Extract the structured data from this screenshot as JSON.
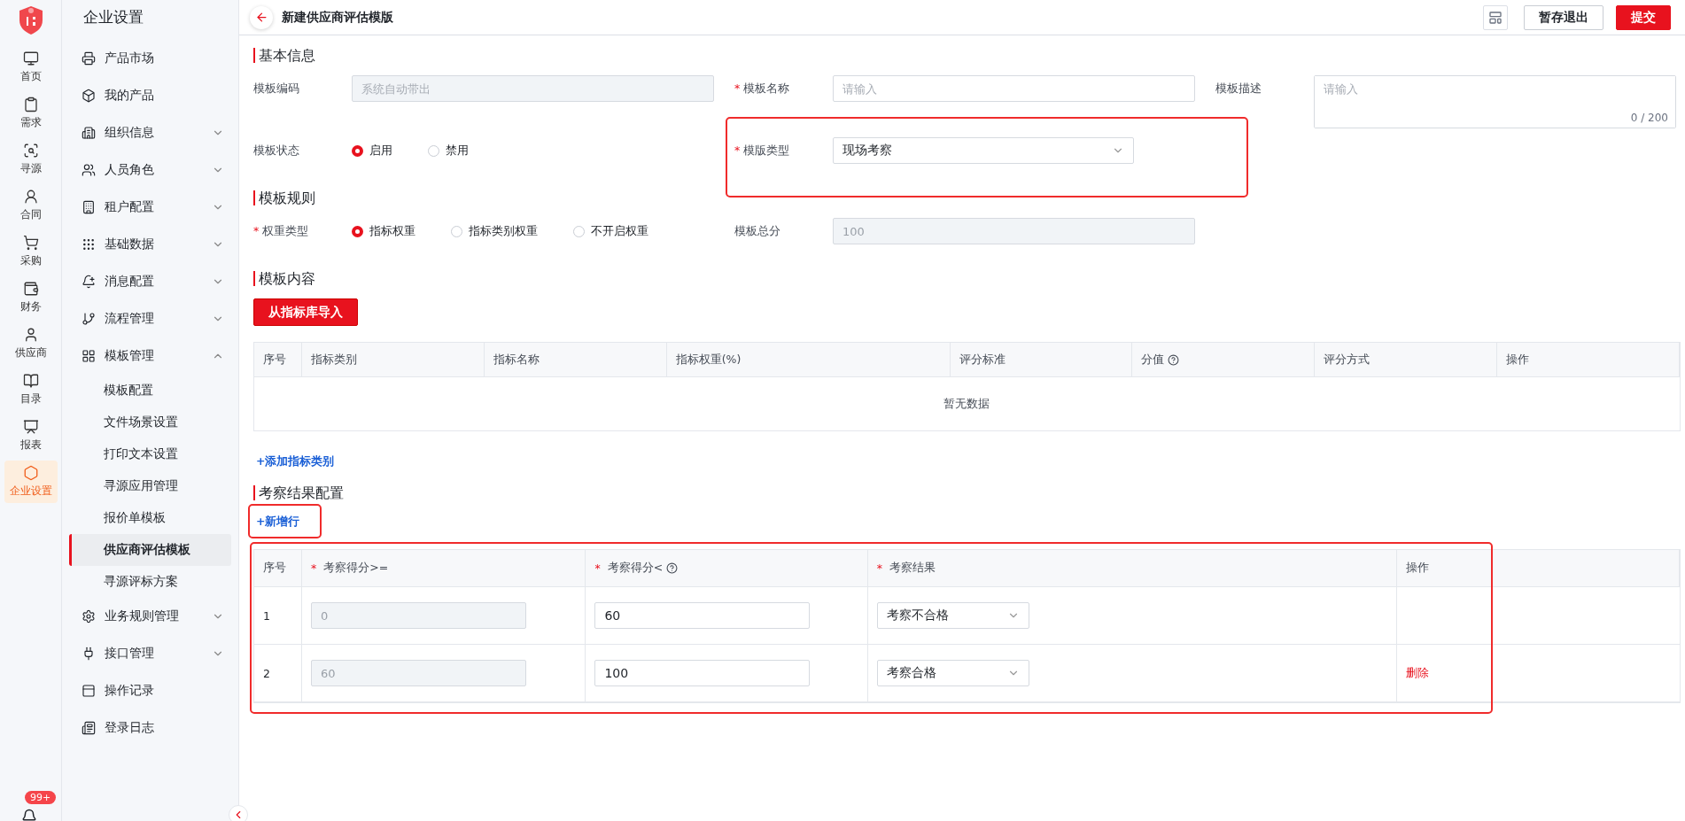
{
  "rail": {
    "items": [
      {
        "label": "首页",
        "selected": false
      },
      {
        "label": "需求",
        "selected": false
      },
      {
        "label": "寻源",
        "selected": false
      },
      {
        "label": "合同",
        "selected": false
      },
      {
        "label": "采购",
        "selected": false
      },
      {
        "label": "财务",
        "selected": false
      },
      {
        "label": "供应商",
        "selected": false
      },
      {
        "label": "目录",
        "selected": false
      },
      {
        "label": "报表",
        "selected": false
      },
      {
        "label": "企业设置",
        "selected": true
      }
    ],
    "badge": "99+"
  },
  "sidebar": {
    "title": "企业设置",
    "items": [
      {
        "label": "产品市场",
        "kind": "link"
      },
      {
        "label": "我的产品",
        "kind": "link"
      },
      {
        "label": "组织信息",
        "kind": "group",
        "expanded": false
      },
      {
        "label": "人员角色",
        "kind": "group",
        "expanded": false
      },
      {
        "label": "租户配置",
        "kind": "group",
        "expanded": false
      },
      {
        "label": "基础数据",
        "kind": "group",
        "expanded": false
      },
      {
        "label": "消息配置",
        "kind": "group",
        "expanded": false
      },
      {
        "label": "流程管理",
        "kind": "group",
        "expanded": false
      },
      {
        "label": "模板管理",
        "kind": "group",
        "expanded": true,
        "children": [
          {
            "label": "模板配置",
            "selected": false
          },
          {
            "label": "文件场景设置",
            "selected": false
          },
          {
            "label": "打印文本设置",
            "selected": false
          },
          {
            "label": "寻源应用管理",
            "selected": false
          },
          {
            "label": "报价单模板",
            "selected": false
          },
          {
            "label": "供应商评估模板",
            "selected": true
          },
          {
            "label": "寻源评标方案",
            "selected": false
          }
        ]
      },
      {
        "label": "业务规则管理",
        "kind": "group",
        "expanded": false
      },
      {
        "label": "接口管理",
        "kind": "group",
        "expanded": false
      },
      {
        "label": "操作记录",
        "kind": "link"
      },
      {
        "label": "登录日志",
        "kind": "link"
      }
    ]
  },
  "header": {
    "title": "新建供应商评估模版",
    "buttons": [
      {
        "label": "暂存退出",
        "kind": "secondary"
      },
      {
        "label": "提交",
        "kind": "primary"
      }
    ]
  },
  "basic": {
    "title": "基本信息",
    "fields": [
      {
        "label": "模板编码",
        "kind": "input",
        "disabled": true,
        "placeholder": "系统自动带出"
      },
      {
        "label": "模板名称",
        "kind": "input",
        "mark": "*",
        "disabled": false,
        "placeholder": "请输入"
      },
      {
        "label": "模板描述",
        "kind": "textarea",
        "placeholder": "请输入",
        "counter": "0 / 200"
      },
      {
        "label": "模板状态",
        "kind": "radio",
        "options": [
          {
            "label": "启用",
            "selected": true
          },
          {
            "label": "禁用",
            "selected": false
          }
        ]
      },
      {
        "label": "模版类型",
        "kind": "select",
        "mark": "*",
        "value": "现场考察",
        "highlighted": true
      }
    ]
  },
  "rules": {
    "title": "模板规则",
    "fields": [
      {
        "label": "权重类型",
        "kind": "radio",
        "mark": "*",
        "options": [
          {
            "label": "指标权重",
            "selected": true
          },
          {
            "label": "指标类别权重",
            "selected": false
          },
          {
            "label": "不开启权重",
            "selected": false
          }
        ]
      },
      {
        "label": "模板总分",
        "kind": "input",
        "disabled": true,
        "value": "100"
      }
    ]
  },
  "content": {
    "title": "模板内容",
    "import_button": "从指标库导入",
    "columns": [
      {
        "label": "序号",
        "help": false
      },
      {
        "label": "指标类别",
        "help": false
      },
      {
        "label": "指标名称",
        "help": false
      },
      {
        "label": "指标权重(%)",
        "help": false
      },
      {
        "label": "评分标准",
        "help": false
      },
      {
        "label": "分值",
        "help": true
      },
      {
        "label": "评分方式",
        "help": false
      },
      {
        "label": "操作",
        "help": false
      }
    ],
    "empty_text": "暂无数据",
    "add_link": "+添加指标类别"
  },
  "results": {
    "title": "考察结果配置",
    "add_link": "+新增行",
    "add_link_highlighted": true,
    "table_highlighted": true,
    "columns": [
      {
        "label": "序号",
        "help": false
      },
      {
        "label": "考察得分>=",
        "mark": "*",
        "help": false
      },
      {
        "label": "考察得分<",
        "mark": "*",
        "help": true
      },
      {
        "label": "考察结果",
        "mark": "*",
        "help": false
      },
      {
        "label": "操作",
        "help": false
      }
    ],
    "rows": [
      {
        "index": "1",
        "min": "0",
        "max": "60",
        "result": "考察不合格"
      },
      {
        "index": "2",
        "min": "60",
        "max": "100",
        "result": "考察合格",
        "action": "删除"
      }
    ]
  }
}
